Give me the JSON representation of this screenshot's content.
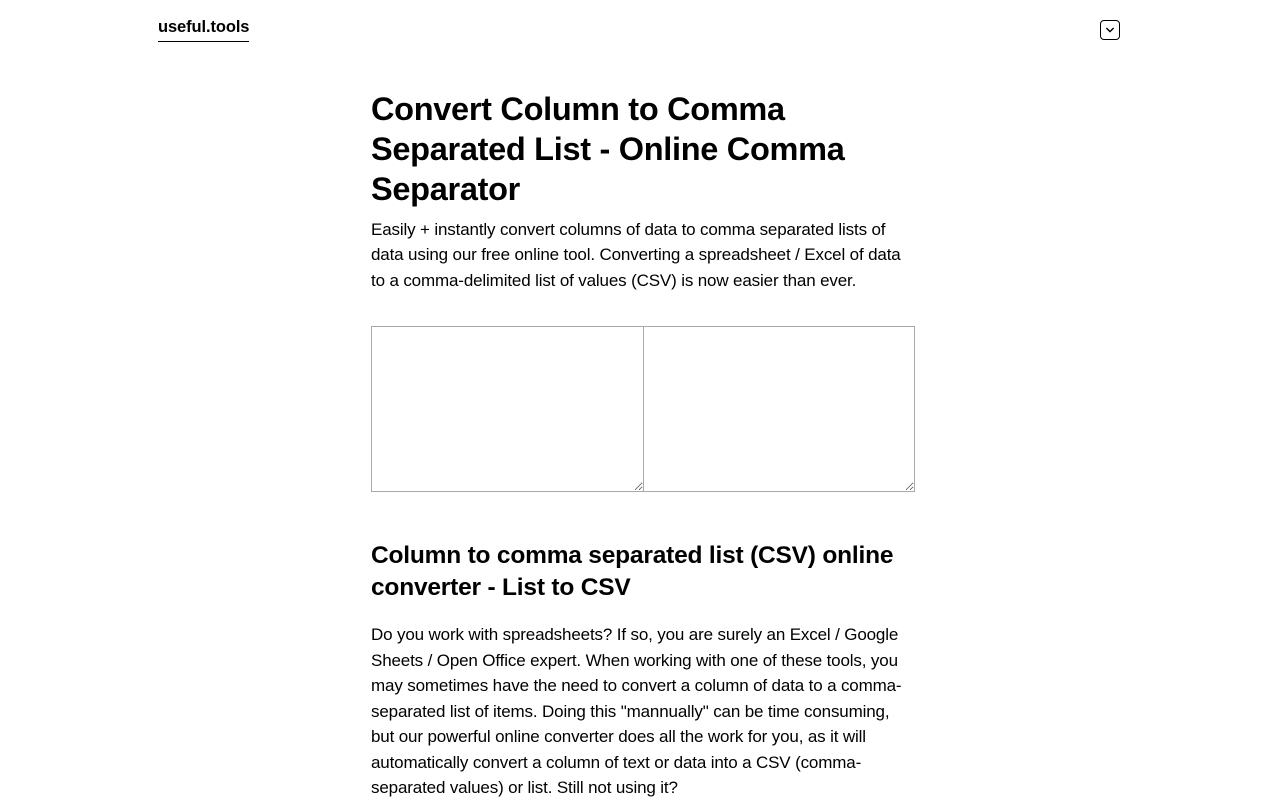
{
  "header": {
    "logo": "useful.tools"
  },
  "main": {
    "title": "Convert Column to Comma Separated List - Online Comma Separator",
    "subtitle": "Easily + instantly convert columns of data to comma separated lists of data using our free online tool. Converting a spreadsheet / Excel of data to a comma-delimited list of values (CSV) is now easier than ever.",
    "input_value": "",
    "output_value": "",
    "section_heading": "Column to comma separated list (CSV) online converter - List to CSV",
    "section_body": "Do you work with spreadsheets? If so, you are surely an Excel / Google Sheets / Open Office expert. When working with one of these tools, you may sometimes have the need to convert a column of data to a comma-separated list of items. Doing this \"mannually\" can be time consuming, but our powerful online converter does all the work for you, as it will automatically convert a column of text or data into a CSV (comma-separated values) or list. Still not using it?"
  }
}
